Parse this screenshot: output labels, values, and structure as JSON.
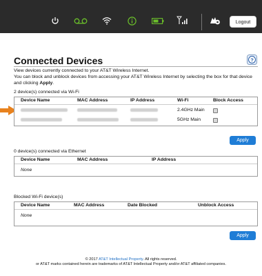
{
  "topbar": {
    "logout_label": "Logout",
    "colors": {
      "bg": "#2b2b2b",
      "voicemail": "#6bbf2a",
      "info": "#6bbf2a",
      "battery": "#6bbf2a"
    },
    "icons": [
      "power-icon",
      "voicemail-icon",
      "wifi-icon",
      "info-icon",
      "battery-icon",
      "signal-icon",
      "settings-gear-icon"
    ]
  },
  "page": {
    "title": "Connected Devices",
    "intro_line1": "View devices currently connected to your AT&T Wireless Internet.",
    "intro_line2_a": "You can block and unblock devices from accessing your AT&T Wireless Internet by selecting the box for that device and clicking ",
    "intro_line2_b": "Apply",
    "intro_line2_c": "."
  },
  "wifi_section": {
    "label": "2 device(s) connected via Wi-Fi",
    "columns": [
      "Device Name",
      "MAC Address",
      "IP Address",
      "Wi-Fi",
      "Block Access"
    ],
    "rows": [
      {
        "wifi": "2.4GHz Main"
      },
      {
        "wifi": "5GHz Main"
      }
    ],
    "apply_label": "Apply"
  },
  "ethernet_section": {
    "label": "0 device(s) connected via Ethernet",
    "columns": [
      "Device Name",
      "MAC Address",
      "IP Address"
    ],
    "empty": "None"
  },
  "blocked_section": {
    "label": "Blocked Wi-Fi device(s)",
    "columns": [
      "Device Name",
      "MAC Address",
      "Date Blocked",
      "Unblock Access"
    ],
    "empty": "None",
    "apply_label": "Apply"
  },
  "footer": {
    "copyright_prefix": "© 2017 ",
    "copyright_link": "AT&T Intellectual Property",
    "copyright_suffix": ". All rights reserved.",
    "trademark": "or AT&T marks contained herein are trademarks of AT&T Intellectual Property and/or AT&T affiliated companies."
  },
  "accent": {
    "link": "#1f6fc4",
    "button": "#1f7dd6",
    "pointer_arrow": "#e8821e"
  }
}
